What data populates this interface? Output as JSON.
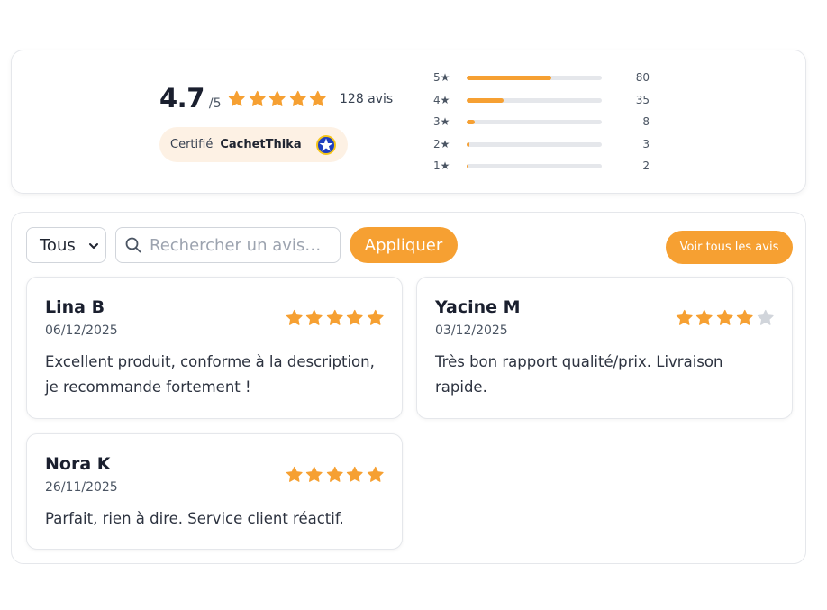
{
  "summary": {
    "average": "4.7",
    "max": "/5",
    "stars": 5,
    "total_label": "128 avis",
    "badge": {
      "label": "Certifié",
      "brand": "CachetThika"
    },
    "distribution": [
      {
        "label": "5★",
        "count": "80",
        "fraction": 0.625
      },
      {
        "label": "4★",
        "count": "35",
        "fraction": 0.273
      },
      {
        "label": "3★",
        "count": "8",
        "fraction": 0.0625
      },
      {
        "label": "2★",
        "count": "3",
        "fraction": 0.023
      },
      {
        "label": "1★",
        "count": "2",
        "fraction": 0.016
      }
    ]
  },
  "toolbar": {
    "filter_value": "Tous",
    "search_placeholder": "Rechercher un avis…",
    "apply_label": "Appliquer",
    "view_all_label": "Voir tous les avis"
  },
  "reviews": [
    {
      "author": "Lina B",
      "date": "06/12/2025",
      "rating": 5,
      "text": "Excellent produit, conforme à la description, je recommande fortement !"
    },
    {
      "author": "Yacine M",
      "date": "03/12/2025",
      "rating": 4,
      "text": "Très bon rapport qualité/prix. Livraison rapide."
    },
    {
      "author": "Nora K",
      "date": "26/11/2025",
      "rating": 5,
      "text": "Parfait, rien à dire. Service client réactif."
    }
  ],
  "colors": {
    "accent": "#f6a032",
    "star_empty": "#d1d5db",
    "badge_bg": "#fdf1e4"
  },
  "icons": {
    "star": "star-icon",
    "search": "search-icon",
    "chevron": "chevron-down-icon",
    "seal": "certification-seal-icon"
  }
}
